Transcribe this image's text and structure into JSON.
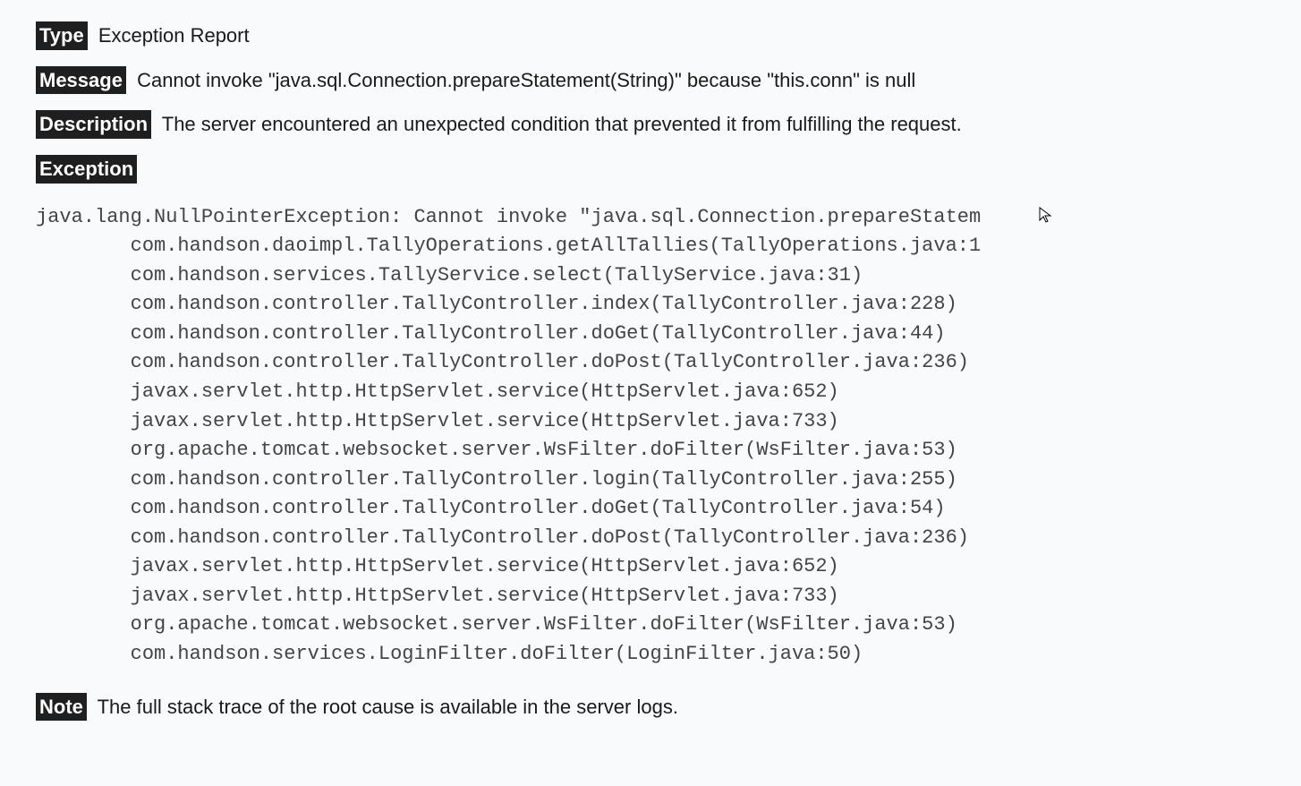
{
  "labels": {
    "type": "Type",
    "message": "Message",
    "description": "Description",
    "exception": "Exception",
    "note": "Note"
  },
  "type_value": "Exception Report",
  "message_value": "Cannot invoke \"java.sql.Connection.prepareStatement(String)\" because \"this.conn\" is null",
  "description_value": "The server encountered an unexpected condition that prevented it from fulfilling the request.",
  "note_value": "The full stack trace of the root cause is available in the server logs.",
  "stacktrace": "java.lang.NullPointerException: Cannot invoke \"java.sql.Connection.prepareStatem\n        com.handson.daoimpl.TallyOperations.getAllTallies(TallyOperations.java:1\n        com.handson.services.TallyService.select(TallyService.java:31)\n        com.handson.controller.TallyController.index(TallyController.java:228)\n        com.handson.controller.TallyController.doGet(TallyController.java:44)\n        com.handson.controller.TallyController.doPost(TallyController.java:236)\n        javax.servlet.http.HttpServlet.service(HttpServlet.java:652)\n        javax.servlet.http.HttpServlet.service(HttpServlet.java:733)\n        org.apache.tomcat.websocket.server.WsFilter.doFilter(WsFilter.java:53)\n        com.handson.controller.TallyController.login(TallyController.java:255)\n        com.handson.controller.TallyController.doGet(TallyController.java:54)\n        com.handson.controller.TallyController.doPost(TallyController.java:236)\n        javax.servlet.http.HttpServlet.service(HttpServlet.java:652)\n        javax.servlet.http.HttpServlet.service(HttpServlet.java:733)\n        org.apache.tomcat.websocket.server.WsFilter.doFilter(WsFilter.java:53)\n        com.handson.services.LoginFilter.doFilter(LoginFilter.java:50)"
}
